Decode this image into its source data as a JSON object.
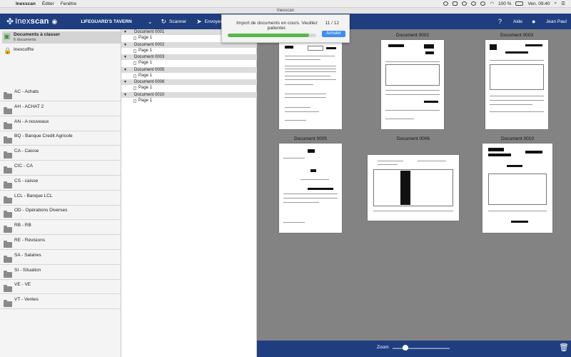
{
  "menubar": {
    "app_name": "Inexscan",
    "items": [
      "Éditer",
      "Fenêtre"
    ],
    "battery": "100 %",
    "clock": "Ven. 09:40"
  },
  "window": {
    "title": "Inexscan"
  },
  "toolbar": {
    "logo_text_light": "Inex",
    "logo_text_bold": "scan",
    "company": "LIFEGUARD'S TAVERN",
    "scan_label": "Scanner",
    "send_label": "Envoyer",
    "help_label": "Aide",
    "user_name": "Jean Paul"
  },
  "import_dialog": {
    "message": "Import de documents en cours. Veuillez patienter.",
    "counter": "11 / 12",
    "progress": 0.92,
    "cancel_label": "Annuler"
  },
  "sidebar": {
    "inbox_title": "Documents à classer",
    "inbox_count": "6 documents",
    "vault_label": "Inexcoffre",
    "journals": [
      "AC  -  Achats",
      "AH  -  ACHAT 2",
      "AN  -  A nouveaux",
      "BQ  -  Banque Credit Agricole",
      "CA  -  Caisse",
      "CIC  -  CA",
      "CS  -  caisse",
      "LCL  -  Banque LCL",
      "OD  -  Opérations Diverses",
      "RB  -  RB",
      "RE  -  Révisions",
      "SA  -  Salaires",
      "SI  -  Situation",
      "VE  -  VE",
      "VT  -  Ventes"
    ]
  },
  "tree": {
    "documents": [
      {
        "name": "Document 0001",
        "page": "Page 1"
      },
      {
        "name": "Document 0002",
        "page": "Page 1"
      },
      {
        "name": "Document 0003",
        "page": "Page 1"
      },
      {
        "name": "Document 0005",
        "page": "Page 1"
      },
      {
        "name": "Document 0006",
        "page": "Page 1"
      },
      {
        "name": "Document 0010",
        "page": "Page 1"
      }
    ]
  },
  "previews": [
    {
      "label": "Document 0002"
    },
    {
      "label": "Document 0003"
    },
    {
      "label": "Document 0005"
    },
    {
      "label": "Document 0006"
    },
    {
      "label": "Document 0010"
    }
  ],
  "footer": {
    "zoom_label": "Zoom",
    "zoom_level": 0.22
  }
}
